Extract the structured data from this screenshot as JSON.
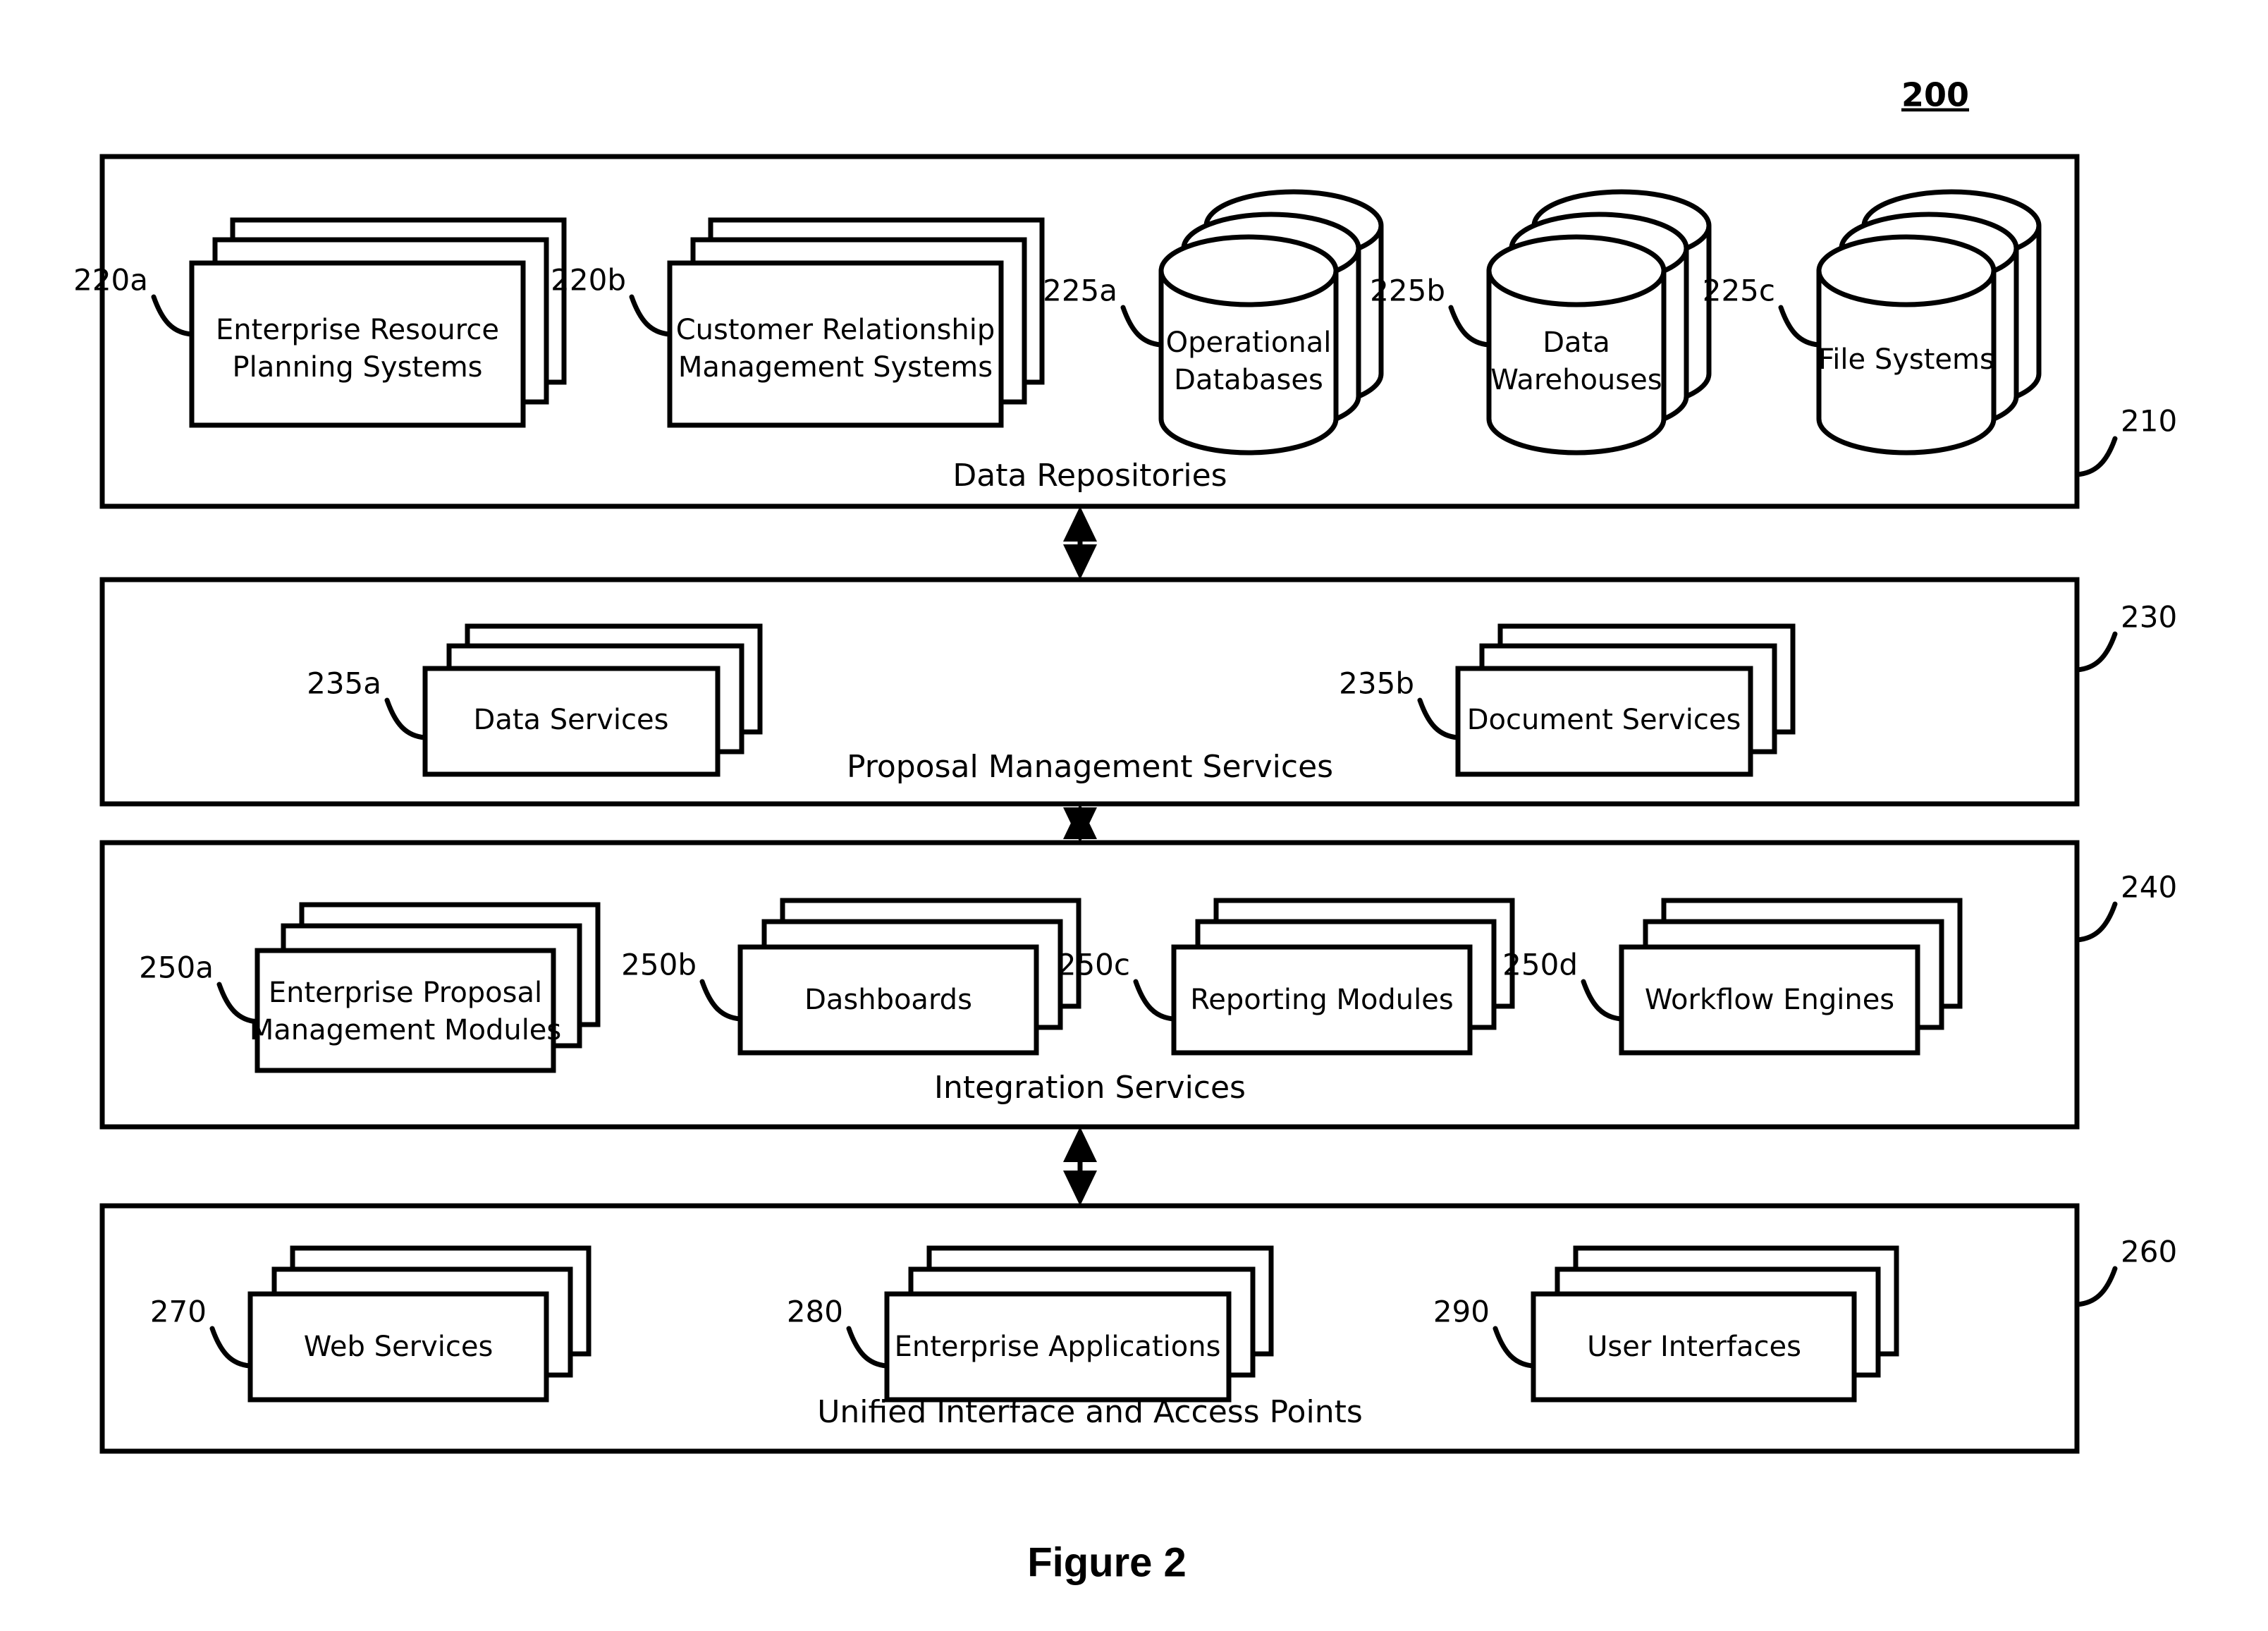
{
  "figure": {
    "number_tag": "200",
    "caption": "Figure 2"
  },
  "layers": [
    {
      "ref": "210",
      "title": "Data Repositories",
      "nodes": [
        {
          "ref": "220a",
          "label_line1": "Enterprise Resource",
          "label_line2": "Planning Systems",
          "shape": "stacked-box"
        },
        {
          "ref": "220b",
          "label_line1": "Customer Relationship",
          "label_line2": "Management Systems",
          "shape": "stacked-box"
        },
        {
          "ref": "225a",
          "label_line1": "Operational",
          "label_line2": "Databases",
          "shape": "stacked-cylinder"
        },
        {
          "ref": "225b",
          "label_line1": "Data",
          "label_line2": "Warehouses",
          "shape": "stacked-cylinder"
        },
        {
          "ref": "225c",
          "label_line1": "File Systems",
          "label_line2": "",
          "shape": "stacked-cylinder"
        }
      ]
    },
    {
      "ref": "230",
      "title": "Proposal Management Services",
      "nodes": [
        {
          "ref": "235a",
          "label_line1": "Data Services",
          "label_line2": "",
          "shape": "stacked-box"
        },
        {
          "ref": "235b",
          "label_line1": "Document Services",
          "label_line2": "",
          "shape": "stacked-box"
        }
      ]
    },
    {
      "ref": "240",
      "title": "Integration Services",
      "nodes": [
        {
          "ref": "250a",
          "label_line1": "Enterprise Proposal",
          "label_line2": "Management Modules",
          "shape": "stacked-box"
        },
        {
          "ref": "250b",
          "label_line1": "Dashboards",
          "label_line2": "",
          "shape": "stacked-box"
        },
        {
          "ref": "250c",
          "label_line1": "Reporting Modules",
          "label_line2": "",
          "shape": "stacked-box"
        },
        {
          "ref": "250d",
          "label_line1": "Workflow Engines",
          "label_line2": "",
          "shape": "stacked-box"
        }
      ]
    },
    {
      "ref": "260",
      "title": "Unified Interface and Access Points",
      "nodes": [
        {
          "ref": "270",
          "label_line1": "Web Services",
          "label_line2": "",
          "shape": "stacked-box"
        },
        {
          "ref": "280",
          "label_line1": "Enterprise Applications",
          "label_line2": "",
          "shape": "stacked-box"
        },
        {
          "ref": "290",
          "label_line1": "User Interfaces",
          "label_line2": "",
          "shape": "stacked-box"
        }
      ]
    }
  ],
  "connectors": [
    {
      "name": "repositories-to-services",
      "kind": "double-arrow-vertical"
    },
    {
      "name": "services-to-integration",
      "kind": "double-arrow-vertical"
    },
    {
      "name": "integration-to-interface",
      "kind": "double-arrow-vertical"
    }
  ],
  "colors": {
    "stroke": "#000000",
    "fill": "#ffffff",
    "background": "#ffffff"
  }
}
